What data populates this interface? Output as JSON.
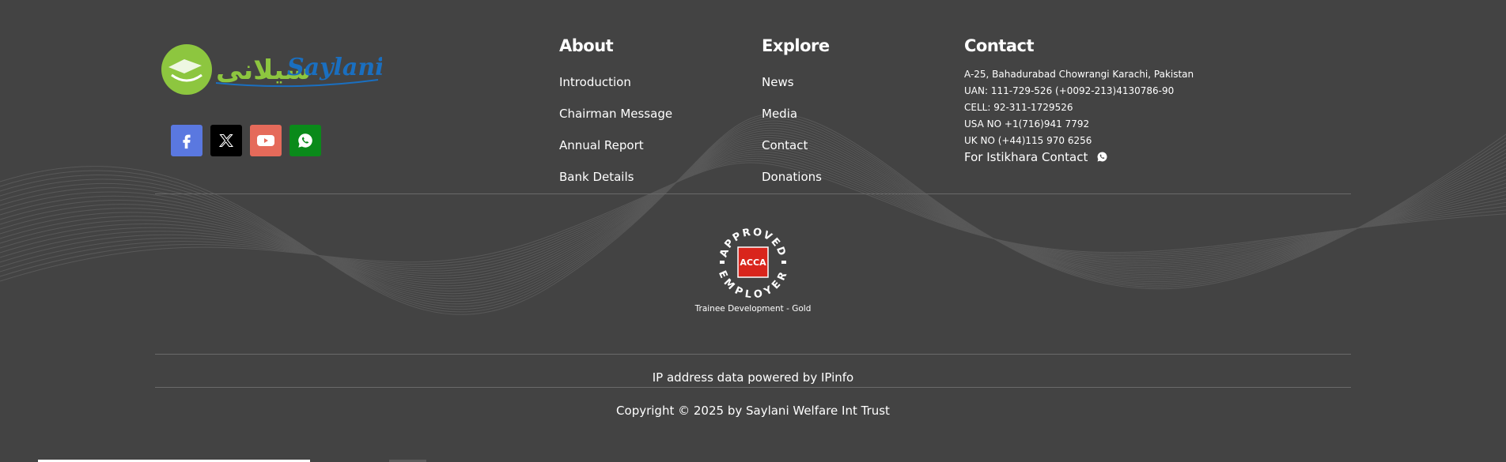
{
  "logo": {
    "urdu_text": "سیلانی",
    "latin_text": "Saylani"
  },
  "social": [
    {
      "name": "facebook",
      "color": "#5a78e0"
    },
    {
      "name": "x",
      "color": "#000000"
    },
    {
      "name": "youtube",
      "color": "#e56a5a"
    },
    {
      "name": "whatsapp",
      "color": "#0a8a1a"
    }
  ],
  "about": {
    "title": "About",
    "links": [
      "Introduction",
      "Chairman Message",
      "Annual Report",
      "Bank Details"
    ]
  },
  "explore": {
    "title": "Explore",
    "links": [
      "News",
      "Media",
      "Contact",
      "Donations"
    ]
  },
  "contact": {
    "title": "Contact",
    "address": "A-25, Bahadurabad Chowrangi Karachi, Pakistan",
    "uan": "UAN: 111-729-526 (+0092-213)4130786-90",
    "cell": "CELL: 92-311-1729526",
    "usa": "USA NO +1(716)941 7792",
    "uk": "UK NO (+44)115 970 6256",
    "istikhara": "For Istikhara Contact"
  },
  "badge": {
    "top_text": "APPROVED",
    "bottom_text": "EMPLOYER",
    "center_text": "ACCA",
    "caption": "Trainee Development - Gold"
  },
  "ipinfo_text": "IP address data powered by IPinfo",
  "copyright": "Copyright © 2025 by Saylani Welfare Int Trust",
  "colors": {
    "background": "#434343",
    "logo_green": "#8dc63f",
    "logo_blue": "#1a6fc0",
    "acca_red": "#d9251c"
  }
}
